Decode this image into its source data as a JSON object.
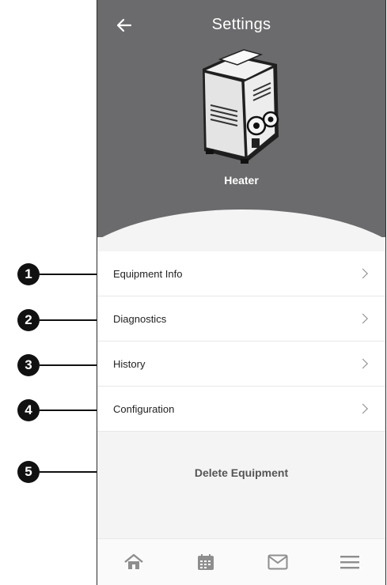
{
  "header": {
    "title": "Settings",
    "back_icon": "arrow-left-icon",
    "device_name": "Heater"
  },
  "menu": {
    "items": [
      {
        "label": "Equipment Info"
      },
      {
        "label": "Diagnostics"
      },
      {
        "label": "History"
      },
      {
        "label": "Configuration"
      }
    ]
  },
  "delete_label": "Delete Equipment",
  "tabbar": {
    "icons": [
      "home-icon",
      "calendar-icon",
      "mail-icon",
      "menu-icon"
    ]
  },
  "callouts": [
    "1",
    "2",
    "3",
    "4",
    "5"
  ],
  "colors": {
    "header_bg": "#6b6b6d",
    "page_bg": "#f4f4f4",
    "badge": "#111111"
  }
}
